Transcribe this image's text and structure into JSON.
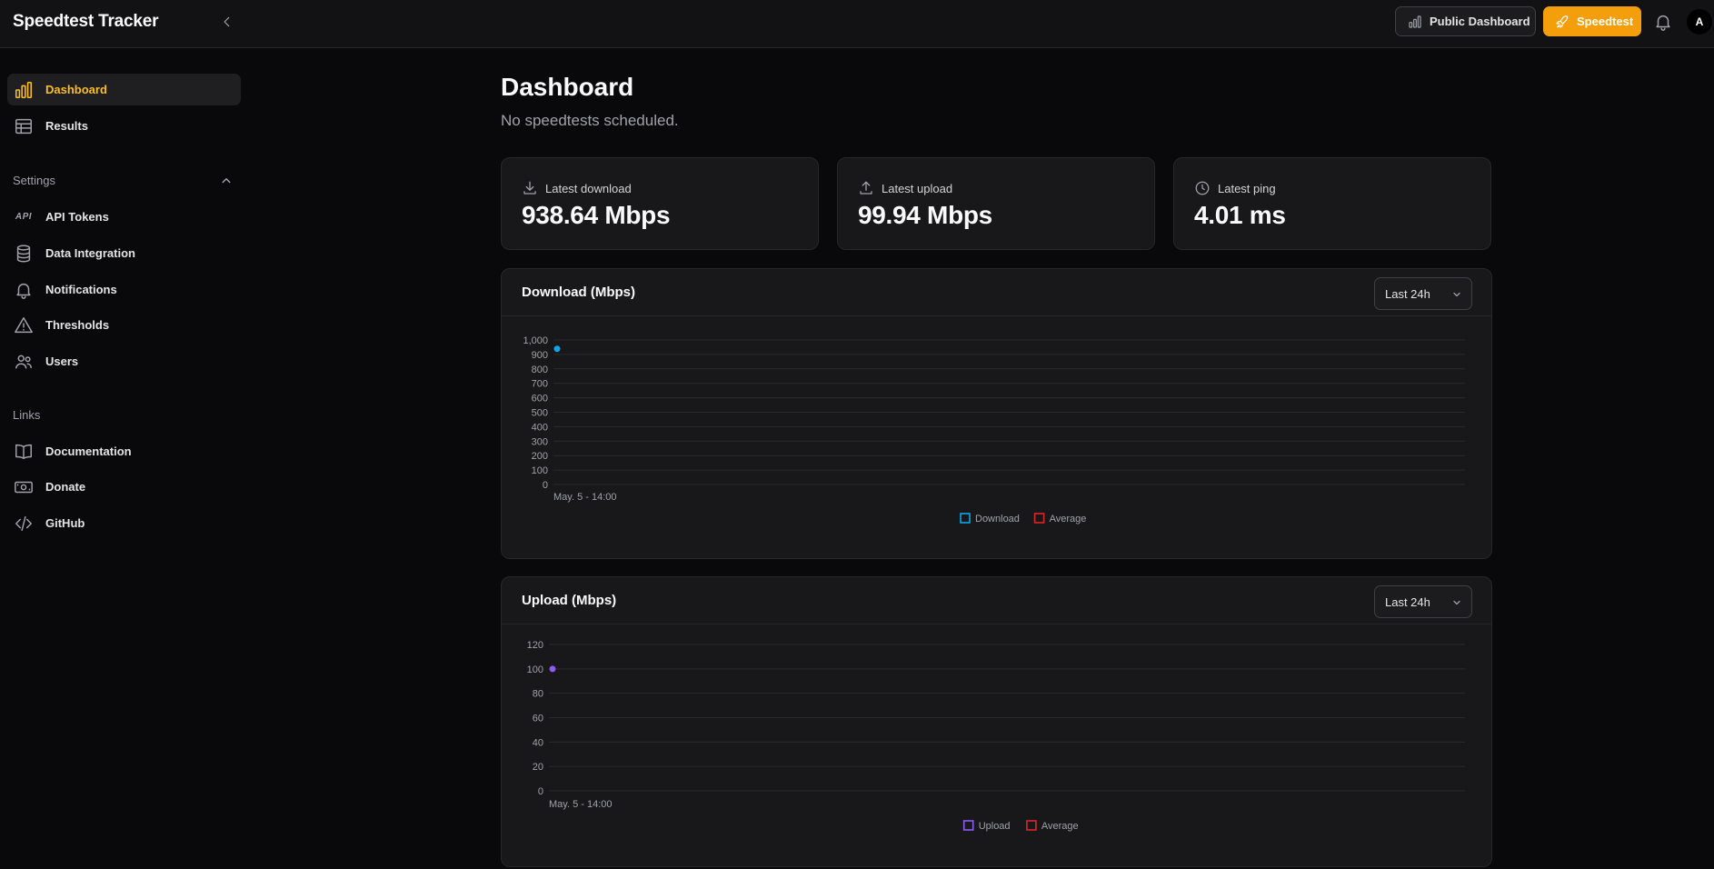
{
  "app": {
    "title": "Speedtest Tracker"
  },
  "header": {
    "public_dashboard_label": "Public Dashboard",
    "speedtest_label": "Speedtest",
    "avatar_initial": "A",
    "accent": "#f59e0b"
  },
  "sidebar": {
    "items": [
      {
        "label": "Dashboard",
        "icon": "bar-chart-icon",
        "active": true
      },
      {
        "label": "Results",
        "icon": "table-icon"
      }
    ],
    "settings": {
      "label": "Settings",
      "items": [
        {
          "label": "API Tokens",
          "icon": "api-icon",
          "icon_text": "API"
        },
        {
          "label": "Data Integration",
          "icon": "database-icon"
        },
        {
          "label": "Notifications",
          "icon": "bell-icon"
        },
        {
          "label": "Thresholds",
          "icon": "warning-icon"
        },
        {
          "label": "Users",
          "icon": "users-icon"
        }
      ]
    },
    "links": {
      "label": "Links",
      "items": [
        {
          "label": "Documentation",
          "icon": "book-icon"
        },
        {
          "label": "Donate",
          "icon": "banknote-icon"
        },
        {
          "label": "GitHub",
          "icon": "code-icon"
        }
      ]
    }
  },
  "page": {
    "title": "Dashboard",
    "subtitle": "No speedtests scheduled."
  },
  "stats": [
    {
      "label": "Latest download",
      "value": "938.64 Mbps",
      "icon": "download-icon"
    },
    {
      "label": "Latest upload",
      "value": "99.94 Mbps",
      "icon": "upload-icon"
    },
    {
      "label": "Latest ping",
      "value": "4.01 ms",
      "icon": "clock-icon"
    }
  ],
  "charts": [
    {
      "title": "Download (Mbps)",
      "range_label": "Last 24h"
    },
    {
      "title": "Upload (Mbps)",
      "range_label": "Last 24h"
    }
  ],
  "chart_data": [
    {
      "type": "line",
      "title": "Download (Mbps)",
      "x": [
        "May. 5 - 14:00"
      ],
      "series": [
        {
          "name": "Download",
          "values": [
            938.64
          ],
          "color": "#0ea5e9"
        },
        {
          "name": "Average",
          "values": [],
          "color": "#dc2626"
        }
      ],
      "ylim": [
        0,
        1000
      ],
      "yticks": [
        0,
        100,
        200,
        300,
        400,
        500,
        600,
        700,
        800,
        900,
        1000
      ],
      "ytick_labels": [
        "0",
        "100",
        "200",
        "300",
        "400",
        "500",
        "600",
        "700",
        "800",
        "900",
        "1,000"
      ],
      "grid": true,
      "legend": "bottom-center"
    },
    {
      "type": "line",
      "title": "Upload (Mbps)",
      "x": [
        "May. 5 - 14:00"
      ],
      "series": [
        {
          "name": "Upload",
          "values": [
            99.94
          ],
          "color": "#8b5cf6"
        },
        {
          "name": "Average",
          "values": [],
          "color": "#dc2626"
        }
      ],
      "ylim": [
        0,
        120
      ],
      "yticks": [
        0,
        20,
        40,
        60,
        80,
        100,
        120
      ],
      "ytick_labels": [
        "0",
        "20",
        "40",
        "60",
        "80",
        "100",
        "120"
      ],
      "grid": true,
      "legend": "bottom-center"
    }
  ]
}
